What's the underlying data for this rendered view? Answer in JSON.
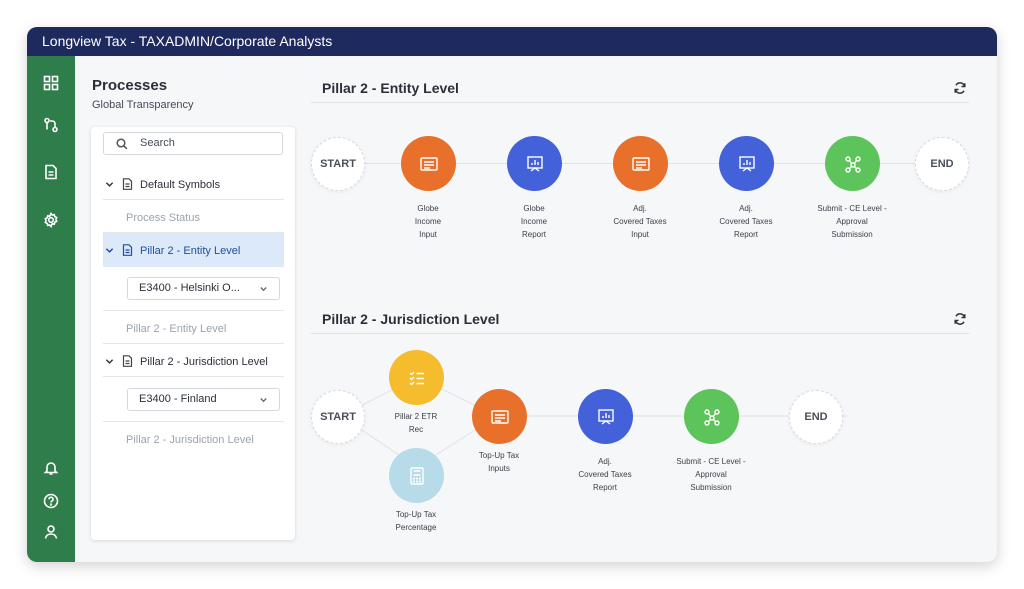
{
  "window": {
    "title": "Longview Tax - TAXADMIN/Corporate Analysts"
  },
  "rail": {
    "top_icons": [
      "dashboard-icon",
      "workflow-icon",
      "document-icon",
      "settings-icon"
    ],
    "bottom_icons": [
      "bell-icon",
      "help-icon",
      "user-icon"
    ]
  },
  "panel": {
    "title": "Processes",
    "subtitle": "Global Transparency",
    "search_placeholder": "Search",
    "tree": {
      "default_symbols": "Default Symbols",
      "process_status": "Process Status",
      "entity_level": "Pillar 2 - Entity Level",
      "entity_dropdown": "E3400 - Helsinki O...",
      "entity_level_leaf": "Pillar 2 - Entity Level",
      "jurisdiction_level": "Pillar 2 - Jurisdiction Level",
      "jurisdiction_dropdown": "E3400 - Finland",
      "jurisdiction_level_leaf": "Pillar 2 - Jurisdiction Level"
    }
  },
  "entity_flow": {
    "title": "Pillar 2 - Entity Level",
    "start": "START",
    "end": "END",
    "nodes": [
      {
        "label": "Globe\nIncome\nInput",
        "color": "#e8702a",
        "icon": "input-form-icon"
      },
      {
        "label": "Globe\nIncome\nReport",
        "color": "#4361d8",
        "icon": "report-chart-icon"
      },
      {
        "label": "Adj.\nCovered Taxes\nInput",
        "color": "#e8702a",
        "icon": "input-form-icon"
      },
      {
        "label": "Adj.\nCovered Taxes\nReport",
        "color": "#4361d8",
        "icon": "report-chart-icon"
      },
      {
        "label": "Submit - CE Level -\nApproval\nSubmission",
        "color": "#5cc45a",
        "icon": "network-icon"
      }
    ]
  },
  "jurisdiction_flow": {
    "title": "Pillar 2 - Jurisdiction Level",
    "start": "START",
    "end": "END",
    "nodes": [
      {
        "label": "Pillar 2 ETR\nRec",
        "color": "#f5bd2e",
        "icon": "checklist-icon"
      },
      {
        "label": "Top-Up Tax\nPercentage",
        "color": "#b7dbe8",
        "icon": "calculator-icon"
      },
      {
        "label": "Top-Up Tax\nInputs",
        "color": "#e8702a",
        "icon": "input-form-icon"
      },
      {
        "label": "Adj.\nCovered Taxes\nReport",
        "color": "#4361d8",
        "icon": "report-chart-icon"
      },
      {
        "label": "Submit - CE Level -\nApproval\nSubmission",
        "color": "#5cc45a",
        "icon": "network-icon"
      }
    ]
  }
}
